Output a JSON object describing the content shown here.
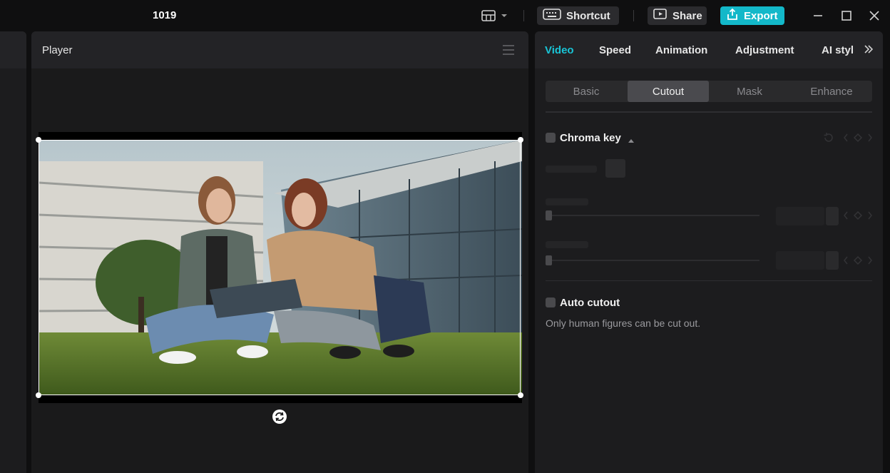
{
  "titlebar": {
    "project_title": "1019",
    "shortcut_label": "Shortcut",
    "share_label": "Share",
    "export_label": "Export",
    "accent_color": "#13b8c9"
  },
  "player": {
    "title": "Player"
  },
  "inspector": {
    "tabs": [
      "Video",
      "Speed",
      "Animation",
      "Adjustment",
      "AI styl"
    ],
    "active_tab": "Video",
    "subtabs": [
      "Basic",
      "Cutout",
      "Mask",
      "Enhance"
    ],
    "active_subtab": "Cutout",
    "chroma_key": {
      "title": "Chroma key",
      "enabled": false
    },
    "auto_cutout": {
      "title": "Auto cutout",
      "enabled": false,
      "note": "Only human figures can be cut out."
    }
  }
}
